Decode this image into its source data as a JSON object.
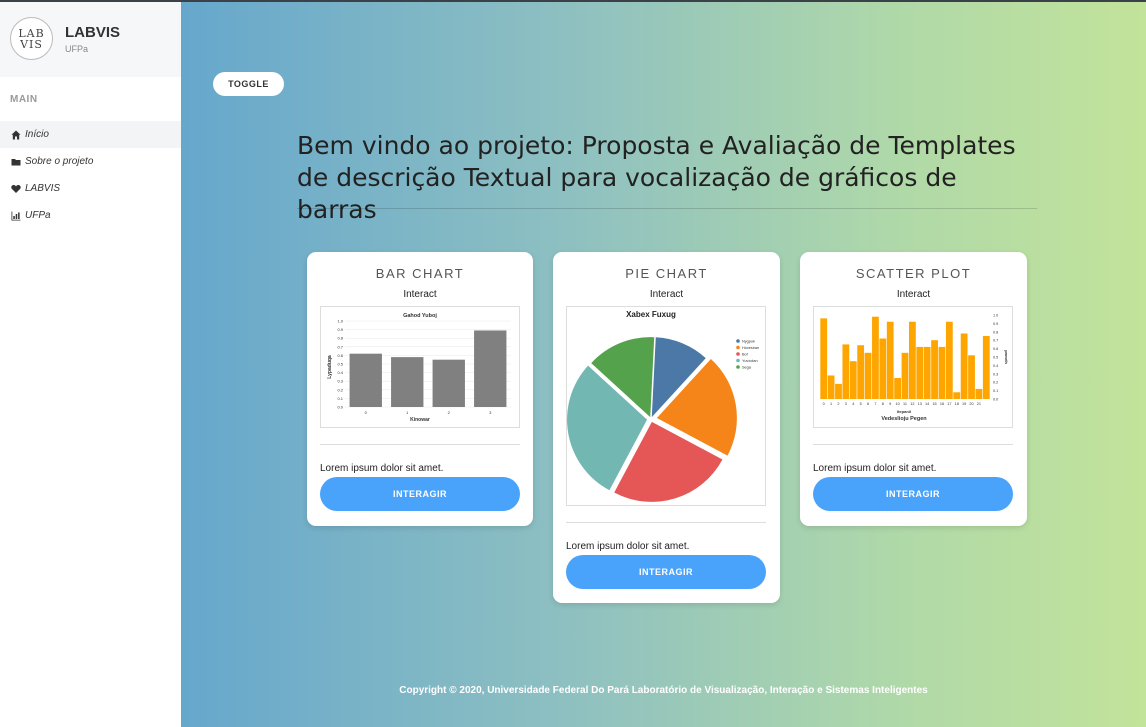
{
  "brand": {
    "logo_text": "LAB VIS",
    "name": "LABVIS",
    "sub": "UFPa"
  },
  "sidebar": {
    "section": "MAIN",
    "items": [
      {
        "label": "Início",
        "icon": "home-icon",
        "active": true
      },
      {
        "label": "Sobre o projeto",
        "icon": "folder-icon"
      },
      {
        "label": "LABVIS",
        "icon": "heart-icon"
      },
      {
        "label": "UFPa",
        "icon": "chart-icon"
      }
    ]
  },
  "toggle_label": "TOGGLE",
  "headline": "Bem vindo ao projeto: Proposta e Avaliação de Templates de descrição Textual para vocalização de gráficos de barras",
  "cards": [
    {
      "title": "BAR CHART",
      "subtitle": "Interact",
      "text": "Lorem ipsum dolor sit amet.",
      "button": "INTERAGIR"
    },
    {
      "title": "PIE CHART",
      "subtitle": "Interact",
      "text": "Lorem ipsum dolor sit amet.",
      "button": "INTERAGIR"
    },
    {
      "title": "SCATTER PLOT",
      "subtitle": "Interact",
      "text": "Lorem ipsum dolor sit amet.",
      "button": "INTERAGIR"
    }
  ],
  "footer": "Copyright © 2020, Universidade Federal Do Pará Laboratório de Visualização, Interação e Sistemas Inteligentes",
  "chart_data": [
    {
      "type": "bar",
      "title": "Gahod Yuboj",
      "xlabel": "Kinowar",
      "ylabel": "Lypaduqa",
      "categories": [
        "0",
        "1",
        "2",
        "3"
      ],
      "values": [
        0.62,
        0.58,
        0.55,
        0.89
      ],
      "ylim": [
        0,
        1.0
      ],
      "yticks": [
        "0.0",
        "0.1",
        "0.2",
        "0.3",
        "0.4",
        "0.5",
        "0.6",
        "0.7",
        "0.8",
        "0.9",
        "1.0"
      ],
      "color": "#808080"
    },
    {
      "type": "pie",
      "title": "Xabex Fuxug",
      "labels": [
        "Nygpuk",
        "Hovesiran",
        "Bof",
        "Yuvxotan",
        "Sega"
      ],
      "values": [
        11,
        21,
        25,
        29,
        14
      ],
      "colors": [
        "#4c78a8",
        "#f58518",
        "#e45756",
        "#72b7b2",
        "#54a24b"
      ]
    },
    {
      "type": "bar",
      "title": "",
      "xlabel": "Vedeslioju Pegen",
      "x_sublabel": "Itepanil",
      "ylabel": "pnmrih",
      "categories": [
        "0",
        "",
        "1",
        "",
        "2",
        "",
        "3",
        "",
        "4",
        "",
        "5",
        "",
        "6",
        "",
        "7",
        "",
        "8",
        "",
        "9",
        "",
        "10",
        "",
        "11",
        "",
        "12",
        "",
        "13",
        "",
        "14",
        "",
        "15",
        "",
        "16",
        "",
        "17",
        "",
        "18",
        "",
        "19",
        "",
        "20",
        "",
        "21",
        ""
      ],
      "values": [
        0.96,
        0.28,
        0.18,
        0.65,
        0.45,
        0.64,
        0.55,
        0.98,
        0.72,
        0.92,
        0.25,
        0.55,
        0.92,
        0.62,
        0.62,
        0.7,
        0.62,
        0.92,
        0.08,
        0.78,
        0.52,
        0.12,
        0.75
      ],
      "ylim": [
        0,
        1.0
      ],
      "yticks": [
        "0.0",
        "0.1",
        "0.2",
        "0.3",
        "0.4",
        "0.5",
        "0.6",
        "0.7",
        "0.8",
        "0.9",
        "1.0"
      ],
      "color": "#ffa500"
    }
  ]
}
